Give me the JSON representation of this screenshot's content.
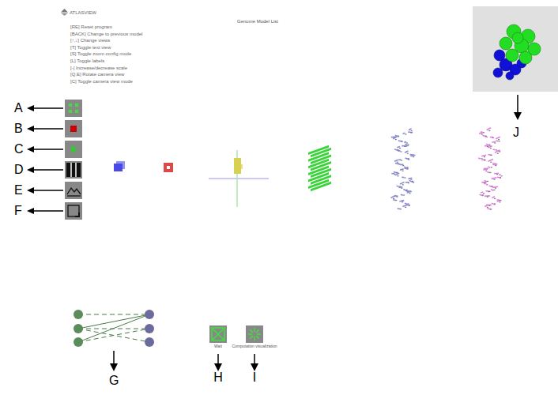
{
  "header": {
    "logo": "ATLASVIEW",
    "title": "Genome Model List"
  },
  "help": [
    "[RE] Reset program",
    "[BACK] Change to previous model",
    "[↑,↓] Change views",
    "[T] Toggle text view",
    "[S] Toggle zoom config mode",
    "[L] Toggle labels",
    "[-] Increase/decrease scale",
    "[Q,E] Rotate camera view",
    "[C] Toggle camera view mode"
  ],
  "toolbar": [
    {
      "label": "A",
      "kind": "grid"
    },
    {
      "label": "B",
      "kind": "stop"
    },
    {
      "label": "C",
      "kind": "play"
    },
    {
      "label": "D",
      "kind": "bars"
    },
    {
      "label": "E",
      "kind": "mountain"
    },
    {
      "label": "F",
      "kind": "corner"
    }
  ],
  "models": [
    {
      "kind": "cube",
      "color": "#4a4ae8"
    },
    {
      "kind": "square",
      "color": "#e04848"
    },
    {
      "kind": "axes",
      "color": "#d8d050"
    },
    {
      "kind": "helix",
      "color": "#3ad43a"
    },
    {
      "kind": "strands",
      "color": "#8a8ad8"
    },
    {
      "kind": "strands",
      "color": "#e080e0"
    }
  ],
  "graph": {
    "label": "G"
  },
  "buttons": [
    {
      "label": "H",
      "caption": "Wait",
      "kind": "bowtie"
    },
    {
      "label": "I",
      "caption": "Computation visualization",
      "kind": "burst"
    }
  ],
  "preview": {
    "label": "J"
  }
}
